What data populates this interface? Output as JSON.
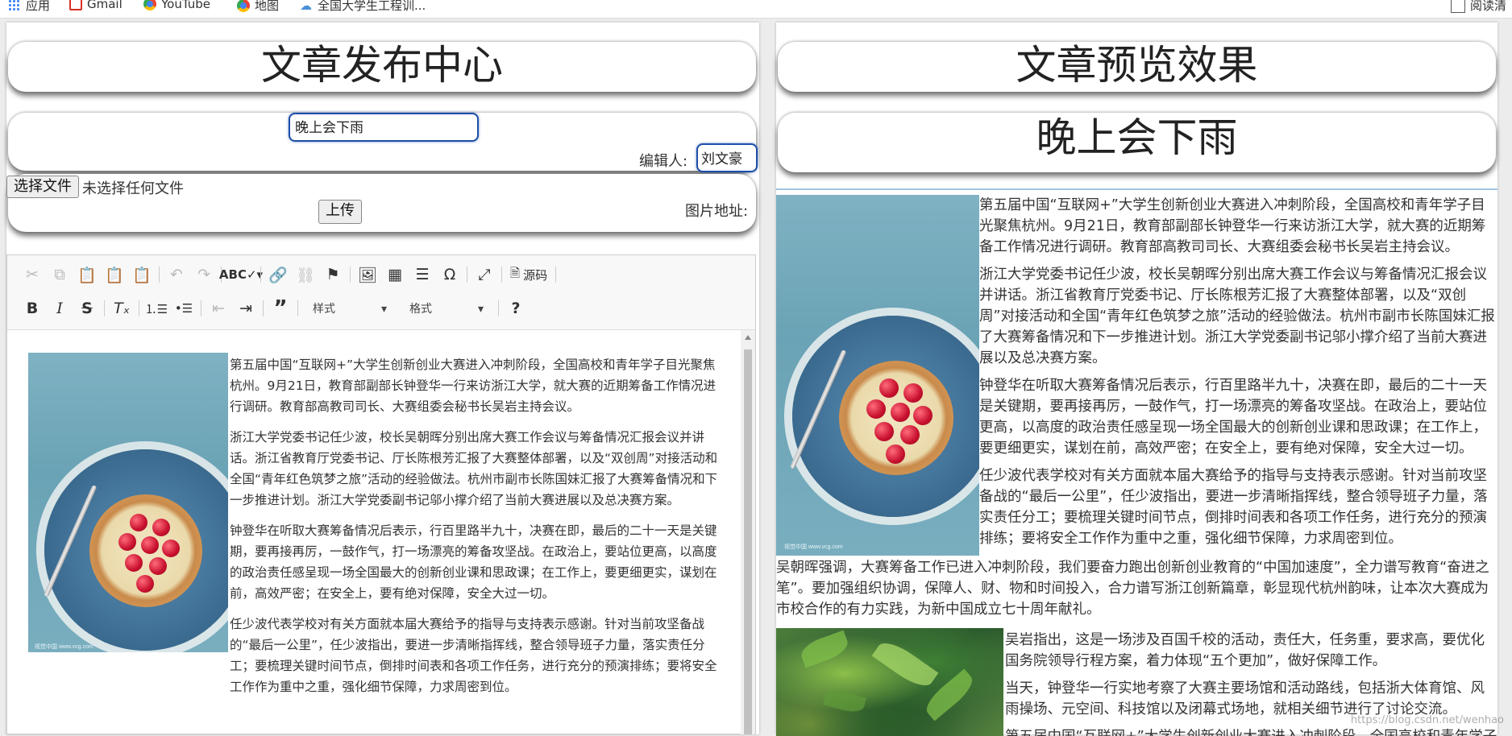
{
  "bookmarks": [
    {
      "label": "应用",
      "icon": "apps-grid-icon"
    },
    {
      "label": "Gmail",
      "icon": "gmail-icon"
    },
    {
      "label": "YouTube",
      "icon": "youtube-icon"
    },
    {
      "label": "地图",
      "icon": "maps-icon"
    },
    {
      "label": "全国大学生工程训...",
      "icon": "cloud-icon"
    }
  ],
  "reading_list": "阅读清",
  "left": {
    "title": "文章发布中心",
    "article_title_value": "晚上会下雨",
    "editor_label": "编辑人:",
    "editor_value": "刘文豪",
    "choose_file_label": "选择文件",
    "no_file_text": "未选择任何文件",
    "upload_label": "上传",
    "image_url_label": "图片地址:"
  },
  "toolbar": {
    "row1": [
      "cut-icon",
      "copy-icon",
      "paste-icon",
      "paste-text-icon",
      "paste-word-icon",
      "undo-icon",
      "redo-icon",
      "spellcheck-icon",
      "link-icon",
      "unlink-icon",
      "anchor-icon",
      "image-icon",
      "table-icon",
      "horizontal-line-icon",
      "special-char-icon",
      "maximize-icon"
    ],
    "source_label": "源码",
    "styles_label": "样式",
    "format_label": "格式"
  },
  "article": {
    "paragraphs": [
      "第五届中国“互联网+”大学生创新创业大赛进入冲刺阶段，全国高校和青年学子目光聚焦杭州。9月21日，教育部副部长钟登华一行来访浙江大学，就大赛的近期筹备工作情况进行调研。教育部高教司司长、大赛组委会秘书长吴岩主持会议。",
      "浙江大学党委书记任少波，校长吴朝晖分别出席大赛工作会议与筹备情况汇报会议并讲话。浙江省教育厅党委书记、厅长陈根芳汇报了大赛整体部署，以及“双创周”对接活动和全国“青年红色筑梦之旅”活动的经验做法。杭州市副市长陈国妹汇报了大赛筹备情况和下一步推进计划。浙江大学党委副书记邬小撑介绍了当前大赛进展以及总决赛方案。",
      "钟登华在听取大赛筹备情况后表示，行百里路半九十，决赛在即，最后的二十一天是关键期，要再接再厉，一鼓作气，打一场漂亮的筹备攻坚战。在政治上，要站位更高，以高度的政治责任感呈现一场全国最大的创新创业课和思政课；在工作上，要更细更实，谋划在前，高效严密；在安全上，要有绝对保障，安全大过一切。",
      "任少波代表学校对有关方面就本届大赛给予的指导与支持表示感谢。针对当前攻坚备战的“最后一公里”，任少波指出，要进一步清晰指挥线，整合领导班子力量，落实责任分工；要梳理关键时间节点，倒排时间表和各项工作任务，进行充分的预演排练；要将安全工作作为重中之重，强化细节保障，力求周密到位。",
      "吴朝晖强调，大赛筹备工作已进入冲刺阶段，我们要奋力跑出创新创业教育的“中国加速度”，全力谱写教育“奋进之笔”。要加强组织协调，保障人、财、物和时间投入，合力谱写浙江创新篇章，彰显现代杭州韵味，让本次大赛成为市校合作的有力实践，为新中国成立七十周年献礼。",
      "吴岩指出，这是一场涉及百国千校的活动，责任大，任务重，要求高，要优化国务院领导行程方案，着力体现“五个更加”，做好保障工作。",
      "当天，钟登华一行实地考察了大赛主要场馆和活动路线，包括浙大体育馆、风雨操场、元空间、科技馆以及闭幕式场地，就相关细节进行了讨论交流。",
      "第五届中国“互联网+”大学生创新创业大赛进入冲刺阶段，全国高校和青年学子"
    ],
    "image_watermark": "视觉中国 www.vcg.com"
  },
  "right": {
    "title": "文章预览效果",
    "preview_title": "晚上会下雨"
  },
  "overlay_url": "https://blog.csdn.net/wenhao"
}
